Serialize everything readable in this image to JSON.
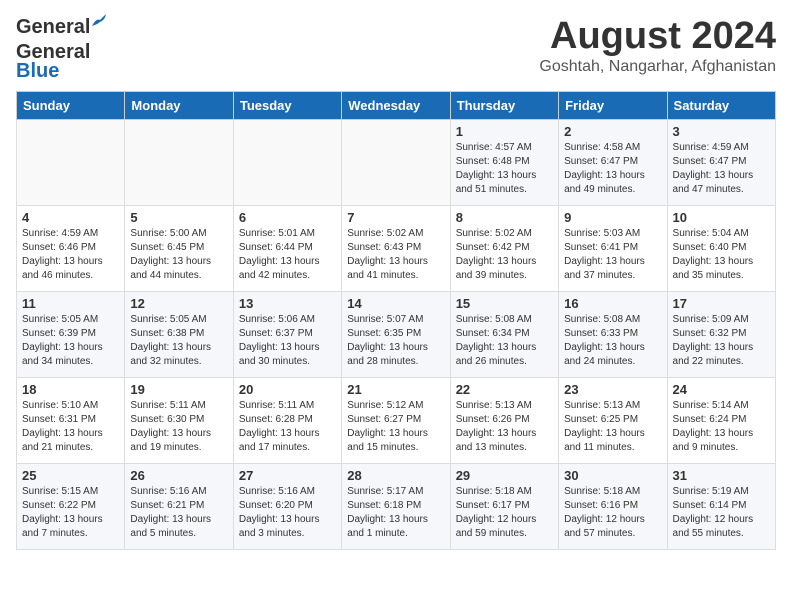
{
  "logo": {
    "general": "General",
    "blue": "Blue"
  },
  "title": "August 2024",
  "location": "Goshtah, Nangarhar, Afghanistan",
  "days_header": [
    "Sunday",
    "Monday",
    "Tuesday",
    "Wednesday",
    "Thursday",
    "Friday",
    "Saturday"
  ],
  "weeks": [
    [
      {
        "day": "",
        "info": ""
      },
      {
        "day": "",
        "info": ""
      },
      {
        "day": "",
        "info": ""
      },
      {
        "day": "",
        "info": ""
      },
      {
        "day": "1",
        "info": "Sunrise: 4:57 AM\nSunset: 6:48 PM\nDaylight: 13 hours\nand 51 minutes."
      },
      {
        "day": "2",
        "info": "Sunrise: 4:58 AM\nSunset: 6:47 PM\nDaylight: 13 hours\nand 49 minutes."
      },
      {
        "day": "3",
        "info": "Sunrise: 4:59 AM\nSunset: 6:47 PM\nDaylight: 13 hours\nand 47 minutes."
      }
    ],
    [
      {
        "day": "4",
        "info": "Sunrise: 4:59 AM\nSunset: 6:46 PM\nDaylight: 13 hours\nand 46 minutes."
      },
      {
        "day": "5",
        "info": "Sunrise: 5:00 AM\nSunset: 6:45 PM\nDaylight: 13 hours\nand 44 minutes."
      },
      {
        "day": "6",
        "info": "Sunrise: 5:01 AM\nSunset: 6:44 PM\nDaylight: 13 hours\nand 42 minutes."
      },
      {
        "day": "7",
        "info": "Sunrise: 5:02 AM\nSunset: 6:43 PM\nDaylight: 13 hours\nand 41 minutes."
      },
      {
        "day": "8",
        "info": "Sunrise: 5:02 AM\nSunset: 6:42 PM\nDaylight: 13 hours\nand 39 minutes."
      },
      {
        "day": "9",
        "info": "Sunrise: 5:03 AM\nSunset: 6:41 PM\nDaylight: 13 hours\nand 37 minutes."
      },
      {
        "day": "10",
        "info": "Sunrise: 5:04 AM\nSunset: 6:40 PM\nDaylight: 13 hours\nand 35 minutes."
      }
    ],
    [
      {
        "day": "11",
        "info": "Sunrise: 5:05 AM\nSunset: 6:39 PM\nDaylight: 13 hours\nand 34 minutes."
      },
      {
        "day": "12",
        "info": "Sunrise: 5:05 AM\nSunset: 6:38 PM\nDaylight: 13 hours\nand 32 minutes."
      },
      {
        "day": "13",
        "info": "Sunrise: 5:06 AM\nSunset: 6:37 PM\nDaylight: 13 hours\nand 30 minutes."
      },
      {
        "day": "14",
        "info": "Sunrise: 5:07 AM\nSunset: 6:35 PM\nDaylight: 13 hours\nand 28 minutes."
      },
      {
        "day": "15",
        "info": "Sunrise: 5:08 AM\nSunset: 6:34 PM\nDaylight: 13 hours\nand 26 minutes."
      },
      {
        "day": "16",
        "info": "Sunrise: 5:08 AM\nSunset: 6:33 PM\nDaylight: 13 hours\nand 24 minutes."
      },
      {
        "day": "17",
        "info": "Sunrise: 5:09 AM\nSunset: 6:32 PM\nDaylight: 13 hours\nand 22 minutes."
      }
    ],
    [
      {
        "day": "18",
        "info": "Sunrise: 5:10 AM\nSunset: 6:31 PM\nDaylight: 13 hours\nand 21 minutes."
      },
      {
        "day": "19",
        "info": "Sunrise: 5:11 AM\nSunset: 6:30 PM\nDaylight: 13 hours\nand 19 minutes."
      },
      {
        "day": "20",
        "info": "Sunrise: 5:11 AM\nSunset: 6:28 PM\nDaylight: 13 hours\nand 17 minutes."
      },
      {
        "day": "21",
        "info": "Sunrise: 5:12 AM\nSunset: 6:27 PM\nDaylight: 13 hours\nand 15 minutes."
      },
      {
        "day": "22",
        "info": "Sunrise: 5:13 AM\nSunset: 6:26 PM\nDaylight: 13 hours\nand 13 minutes."
      },
      {
        "day": "23",
        "info": "Sunrise: 5:13 AM\nSunset: 6:25 PM\nDaylight: 13 hours\nand 11 minutes."
      },
      {
        "day": "24",
        "info": "Sunrise: 5:14 AM\nSunset: 6:24 PM\nDaylight: 13 hours\nand 9 minutes."
      }
    ],
    [
      {
        "day": "25",
        "info": "Sunrise: 5:15 AM\nSunset: 6:22 PM\nDaylight: 13 hours\nand 7 minutes."
      },
      {
        "day": "26",
        "info": "Sunrise: 5:16 AM\nSunset: 6:21 PM\nDaylight: 13 hours\nand 5 minutes."
      },
      {
        "day": "27",
        "info": "Sunrise: 5:16 AM\nSunset: 6:20 PM\nDaylight: 13 hours\nand 3 minutes."
      },
      {
        "day": "28",
        "info": "Sunrise: 5:17 AM\nSunset: 6:18 PM\nDaylight: 13 hours\nand 1 minute."
      },
      {
        "day": "29",
        "info": "Sunrise: 5:18 AM\nSunset: 6:17 PM\nDaylight: 12 hours\nand 59 minutes."
      },
      {
        "day": "30",
        "info": "Sunrise: 5:18 AM\nSunset: 6:16 PM\nDaylight: 12 hours\nand 57 minutes."
      },
      {
        "day": "31",
        "info": "Sunrise: 5:19 AM\nSunset: 6:14 PM\nDaylight: 12 hours\nand 55 minutes."
      }
    ]
  ]
}
